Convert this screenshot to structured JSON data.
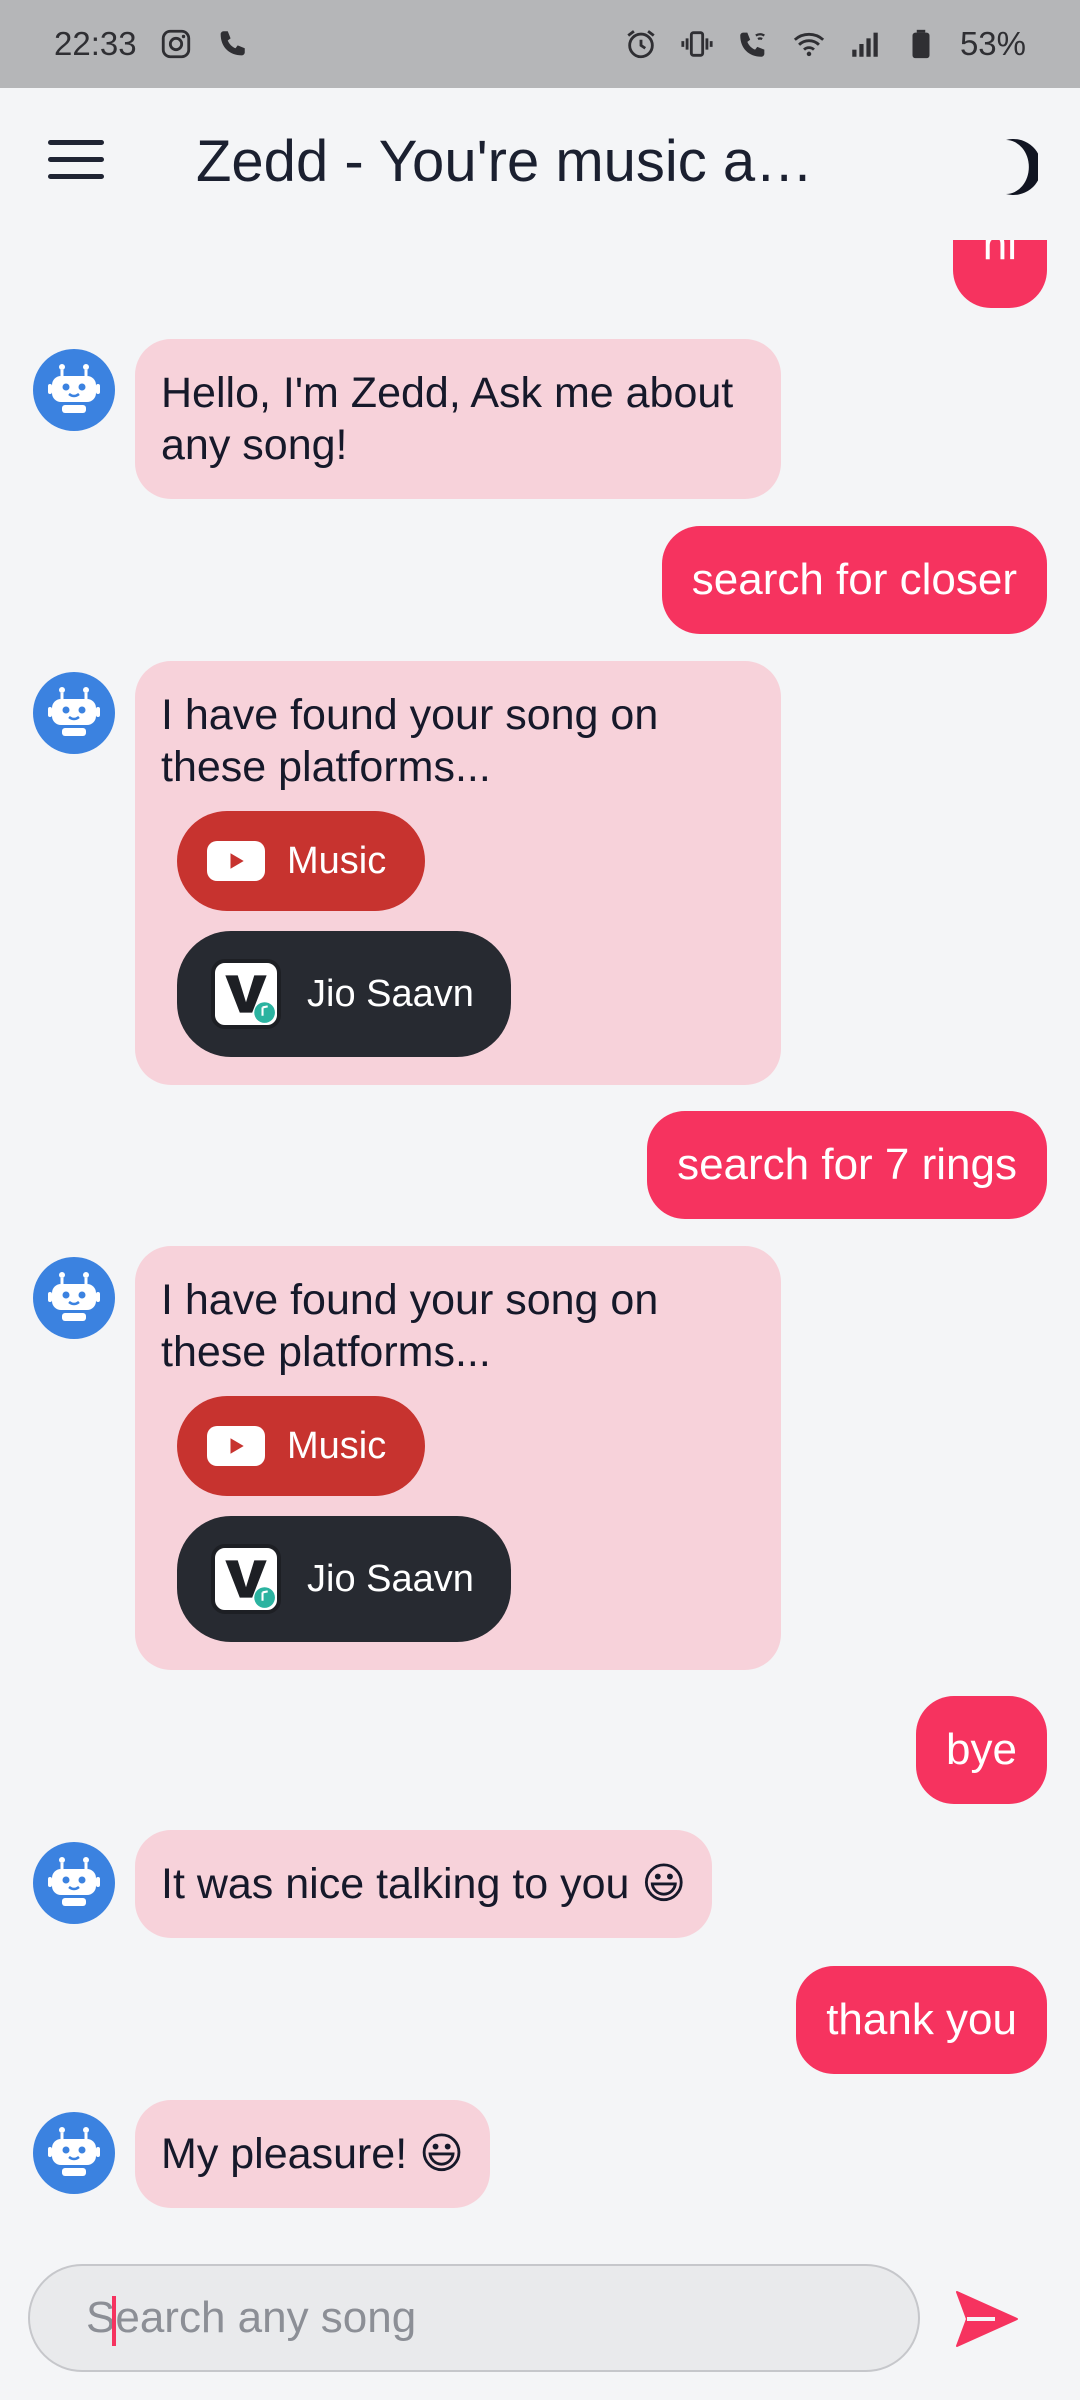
{
  "status_bar": {
    "time": "22:33",
    "battery": "53%",
    "left_icons": [
      "instagram-icon",
      "phone-icon"
    ],
    "right_icons": [
      "alarm-icon",
      "vibrate-icon",
      "wifi-call-icon",
      "wifi-icon",
      "signal-icon",
      "battery-icon"
    ]
  },
  "appbar": {
    "title": "Zedd - You're music assistant",
    "menu_icon": "hamburger-menu-icon",
    "theme_icon": "moon-icon"
  },
  "messages": [
    {
      "from": "user",
      "text": "hi"
    },
    {
      "from": "bot",
      "text": "Hello, I'm Zedd, Ask me about any song!"
    },
    {
      "from": "user",
      "text": "search for closer"
    },
    {
      "from": "bot",
      "text": "I have found your song on these platforms...",
      "buttons": [
        "Music",
        "Jio Saavn"
      ]
    },
    {
      "from": "user",
      "text": "search for 7 rings"
    },
    {
      "from": "bot",
      "text": "I have found your song on these platforms...",
      "buttons": [
        "Music",
        "Jio Saavn"
      ]
    },
    {
      "from": "user",
      "text": "bye"
    },
    {
      "from": "bot",
      "text": "It was nice talking to you 😃"
    },
    {
      "from": "user",
      "text": "thank you"
    },
    {
      "from": "bot",
      "text": "My pleasure! 😃"
    }
  ],
  "input": {
    "placeholder": "Search any song",
    "value": ""
  },
  "colors": {
    "accent": "#f6335f",
    "bot_bubble": "#f7d2da",
    "youtube": "#c7332f",
    "saavn": "#272a31",
    "avatar": "#3b82e0"
  }
}
